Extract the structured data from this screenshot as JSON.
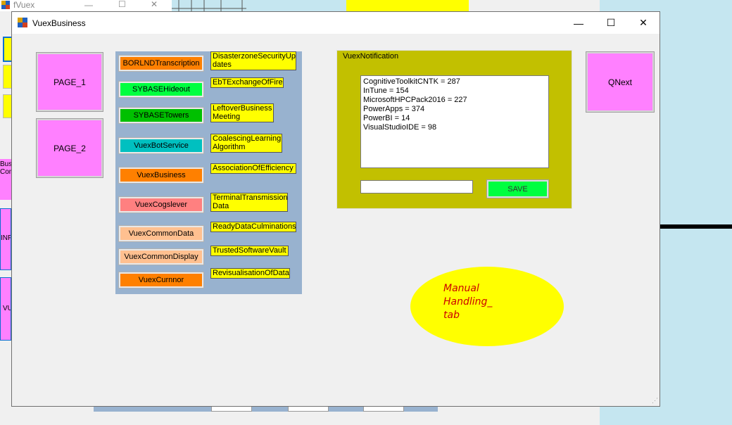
{
  "background_window": {
    "title": "fVuex",
    "side_labels": [
      "Busi",
      "Com",
      "INF",
      "VU"
    ]
  },
  "window": {
    "title": "VuexBusiness",
    "minimize_glyph": "—",
    "maximize_glyph": "☐",
    "close_glyph": "✕"
  },
  "left_buttons": {
    "page1": "PAGE_1",
    "page2": "PAGE_2"
  },
  "qnext": "QNext",
  "center_buttons": [
    {
      "label": "BORLNDTranscription",
      "color": "#ff8000"
    },
    {
      "label": "SYBASEHideout",
      "color": "#00ff40"
    },
    {
      "label": "SYBASETowers",
      "color": "#00c000"
    },
    {
      "label": "VuexBotService",
      "color": "#00c0c0"
    },
    {
      "label": "VuexBusiness",
      "color": "#ff8000"
    },
    {
      "label": "VuexCogslever",
      "color": "#ff8080"
    },
    {
      "label": "VuexCommonData",
      "color": "#ffc090"
    },
    {
      "label": "VuexCommonDisplay",
      "color": "#ffc090"
    },
    {
      "label": "VuexCurnnor",
      "color": "#ff8000"
    }
  ],
  "yellow_labels": [
    {
      "line1": "DisasterzoneSecurityUp",
      "line2": "dates"
    },
    {
      "line1": "EbTExchangeOfFire",
      "line2": ""
    },
    {
      "line1": "LeftoverBusiness",
      "line2": "Meeting"
    },
    {
      "line1": "CoalescingLearning",
      "line2": "Algorithm"
    },
    {
      "line1": "AssociationOfEfficiency",
      "line2": ""
    },
    {
      "line1": "TerminalTransmission",
      "line2": "Data"
    },
    {
      "line1": "ReadyDataCulminations",
      "line2": ""
    },
    {
      "line1": "TrustedSoftwareVault",
      "line2": ""
    },
    {
      "line1": "RevisualisationOfData",
      "line2": ""
    }
  ],
  "notification": {
    "legend": "VuexNotification",
    "lines": [
      "CognitiveToolkitCNTK = 287",
      "InTune = 154",
      "MicrosoftHPCPack2016 = 227",
      "PowerApps = 374",
      "PowerBI = 14",
      "VisualStudioIDE = 98"
    ],
    "input_value": "",
    "save_label": "SAVE"
  },
  "manual_tab": {
    "line1": "Manual",
    "line2": "Handling_",
    "line3": "tab"
  },
  "colors": {
    "pink": "#ff80ff",
    "panel_blue": "#98b2cf",
    "notification_olive": "#c2c000",
    "save_green": "#00ff40",
    "manual_yellow": "#ffff00",
    "manual_text_red": "#cc0000"
  }
}
